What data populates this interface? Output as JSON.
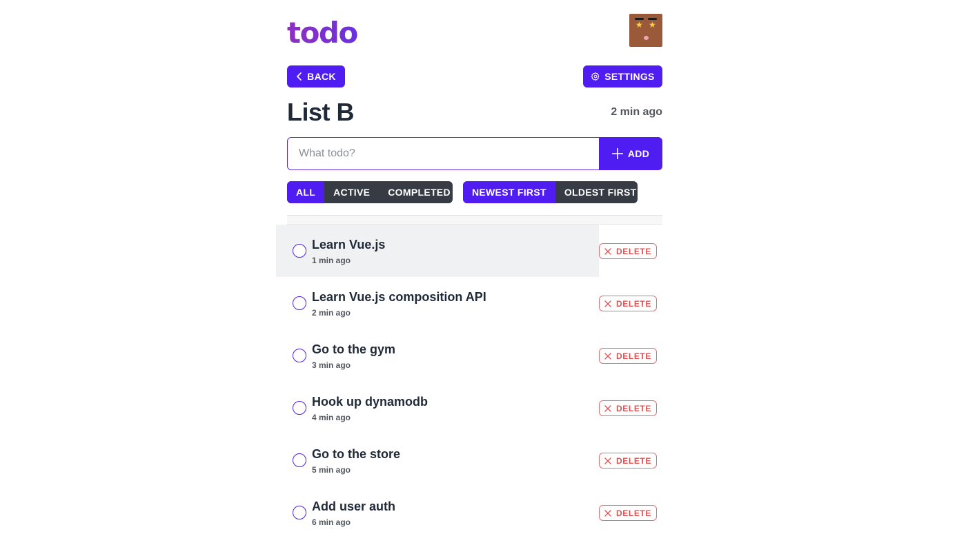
{
  "header": {
    "logo": "todo",
    "avatar_icon": "avatar-icon"
  },
  "nav": {
    "back_label": "BACK",
    "back_icon": "chevron-left-icon",
    "settings_label": "SETTINGS",
    "settings_icon": "gear-icon"
  },
  "list": {
    "title": "List B",
    "updated": "2 min ago"
  },
  "new_todo": {
    "placeholder": "What todo?",
    "value": "",
    "add_label": "ADD",
    "add_icon": "plus-icon"
  },
  "filters": [
    {
      "label": "ALL",
      "active": true
    },
    {
      "label": "ACTIVE",
      "active": false
    },
    {
      "label": "COMPLETED",
      "active": false
    }
  ],
  "sort": [
    {
      "label": "NEWEST FIRST",
      "active": true
    },
    {
      "label": "OLDEST FIRST",
      "active": false
    }
  ],
  "delete_label": "DELETE",
  "todos": [
    {
      "title": "Learn Vue.js",
      "time": "1 min ago",
      "completed": false,
      "hovered": true
    },
    {
      "title": "Learn Vue.js composition API",
      "time": "2 min ago",
      "completed": false,
      "hovered": false
    },
    {
      "title": "Go to the gym",
      "time": "3 min ago",
      "completed": false,
      "hovered": false
    },
    {
      "title": "Hook up dynamodb",
      "time": "4 min ago",
      "completed": false,
      "hovered": false
    },
    {
      "title": "Go to the store",
      "time": "5 min ago",
      "completed": false,
      "hovered": false
    },
    {
      "title": "Add user auth",
      "time": "6 min ago",
      "completed": false,
      "hovered": false
    }
  ],
  "colors": {
    "accent": "#4f1df2",
    "dark": "#363b44",
    "danger": "#e15050",
    "logo_start": "#8f2fc2",
    "logo_end": "#6a31e0"
  }
}
